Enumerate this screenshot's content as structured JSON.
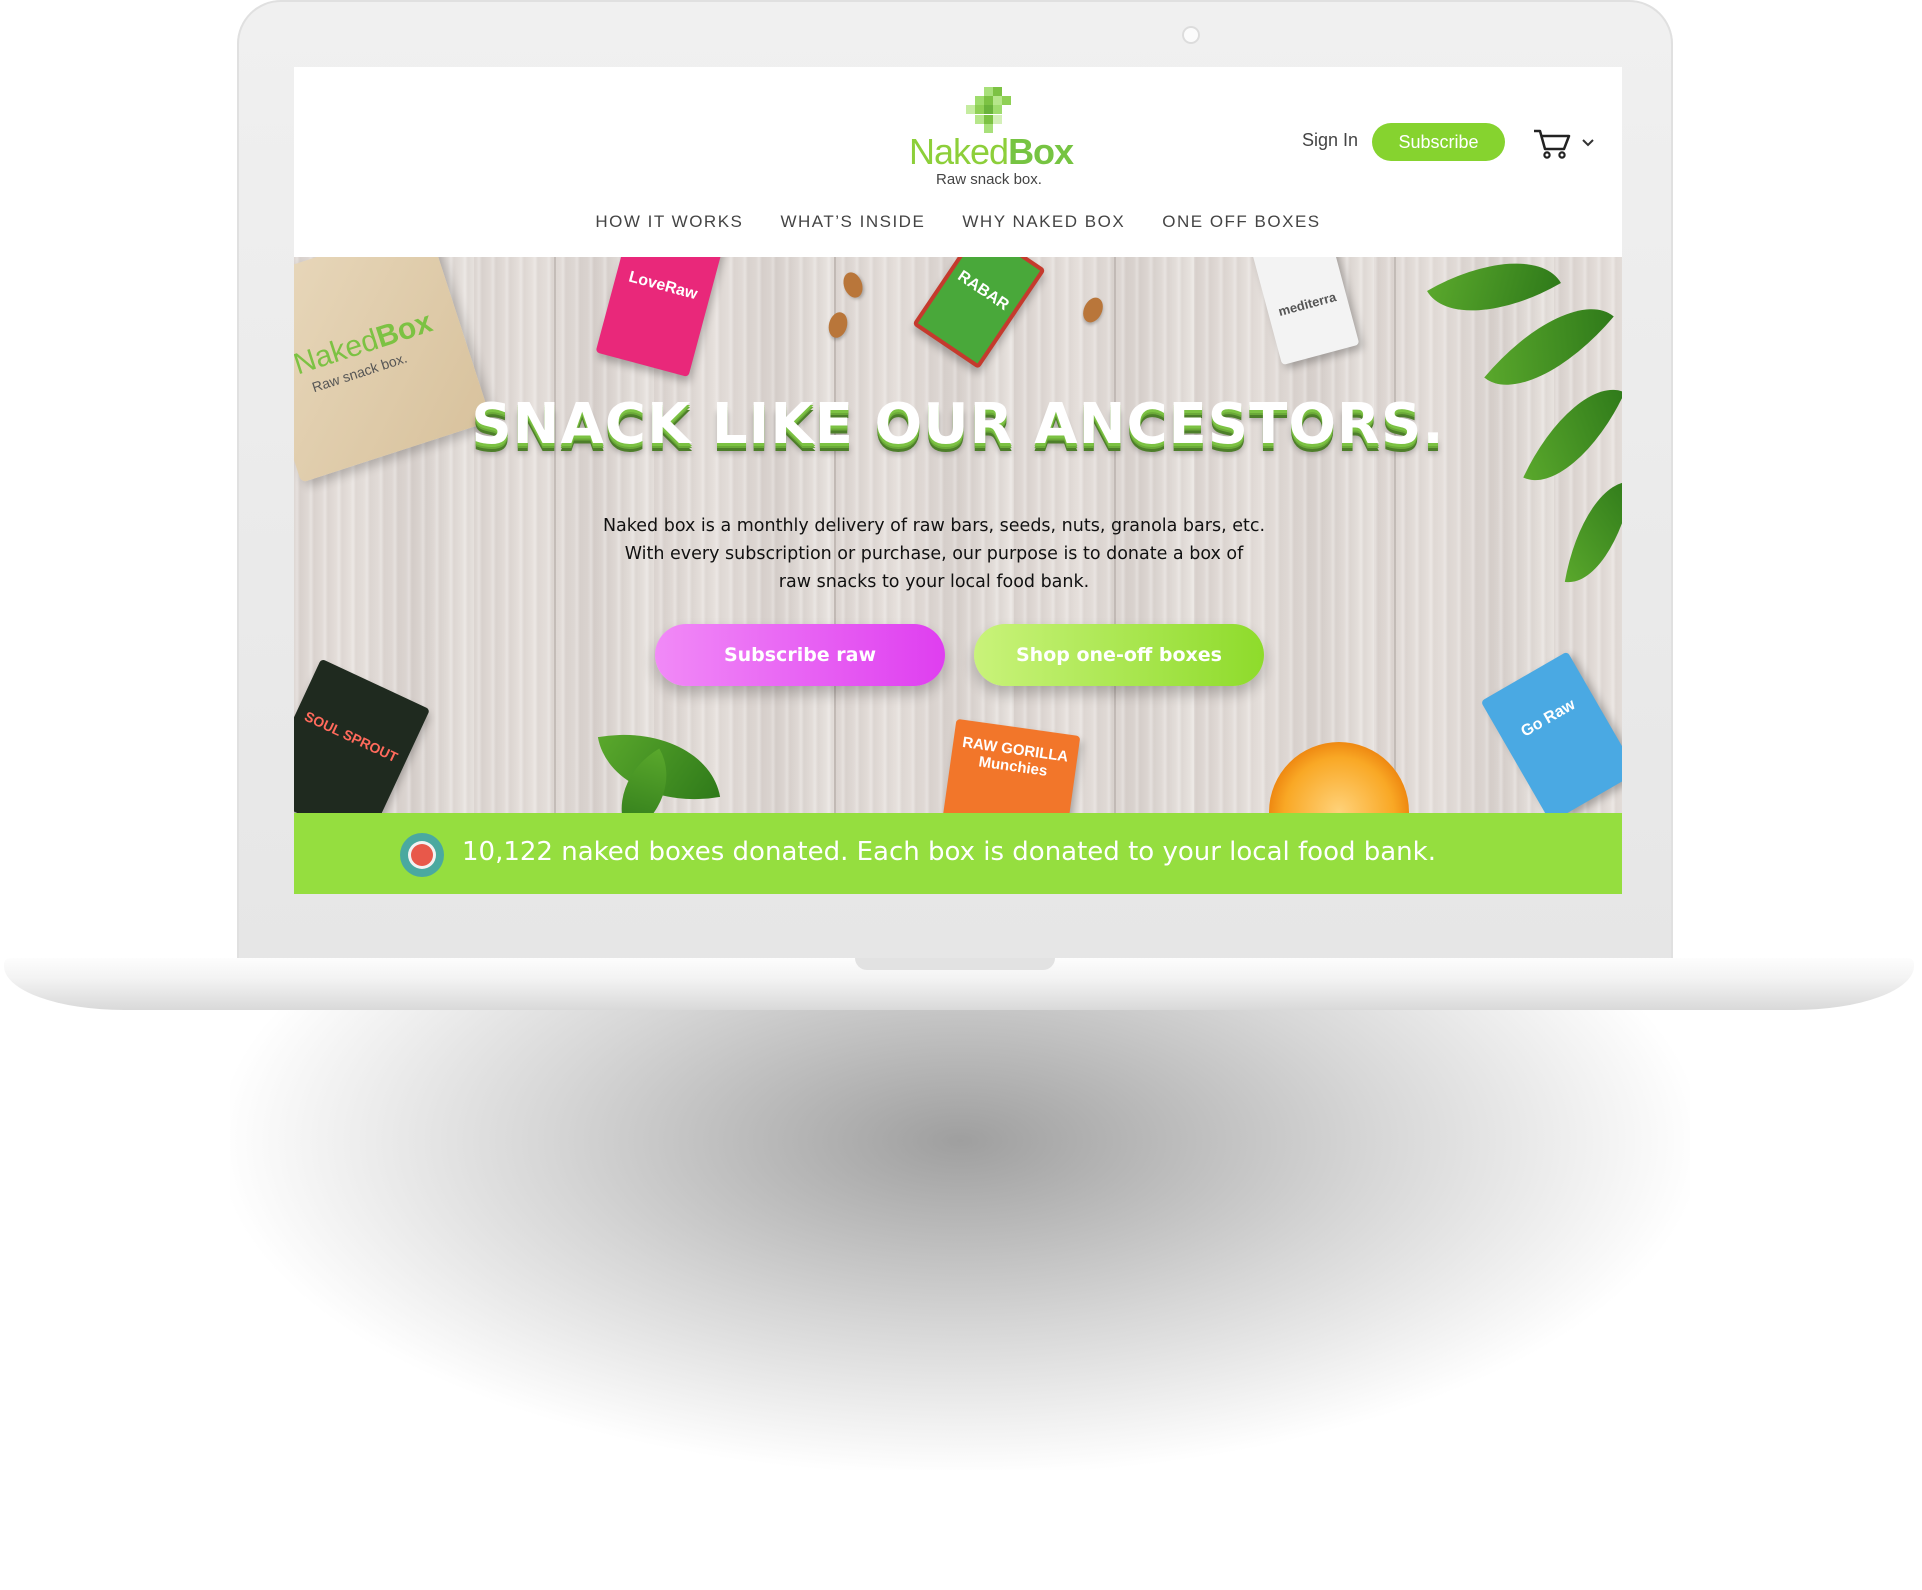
{
  "logo": {
    "brand_first": "Naked",
    "brand_second": "Box",
    "tagline": "Raw snack box."
  },
  "header": {
    "sign_in": "Sign In",
    "subscribe": "Subscribe"
  },
  "nav": {
    "items": [
      {
        "label": "HOW IT WORKS"
      },
      {
        "label": "WHAT’S INSIDE"
      },
      {
        "label": "WHY NAKED BOX"
      },
      {
        "label": "ONE OFF BOXES"
      }
    ]
  },
  "hero": {
    "headline": "SNACK LIKE OUR ANCESTORS.",
    "description_line1": "Naked box is a monthly delivery of  raw bars, seeds, nuts, granola bars, etc.",
    "description_line2": "With every subscription or purchase, our purpose is to donate a box of",
    "description_line3": "raw snacks to your local food bank.",
    "cta_subscribe": "Subscribe raw",
    "cta_shop": "Shop one-off boxes",
    "props": {
      "box_brand_first": "Naked",
      "box_brand_second": "Box",
      "box_tagline": "Raw snack box.",
      "bar_pink": "LoveRaw",
      "bar_green": "RABAR",
      "bar_white": "mediterra",
      "bar_dark": "SOUL SPROUT",
      "bar_orange": "RAW GORILLA Munchies",
      "bar_blue": "Go Raw"
    }
  },
  "donation": {
    "text": "10,122 naked boxes donated. Each box is donated to your local food bank."
  },
  "colors": {
    "brand_green": "#86d32f",
    "banner_green": "#95de3f",
    "pink_cta": "#e040f0"
  }
}
